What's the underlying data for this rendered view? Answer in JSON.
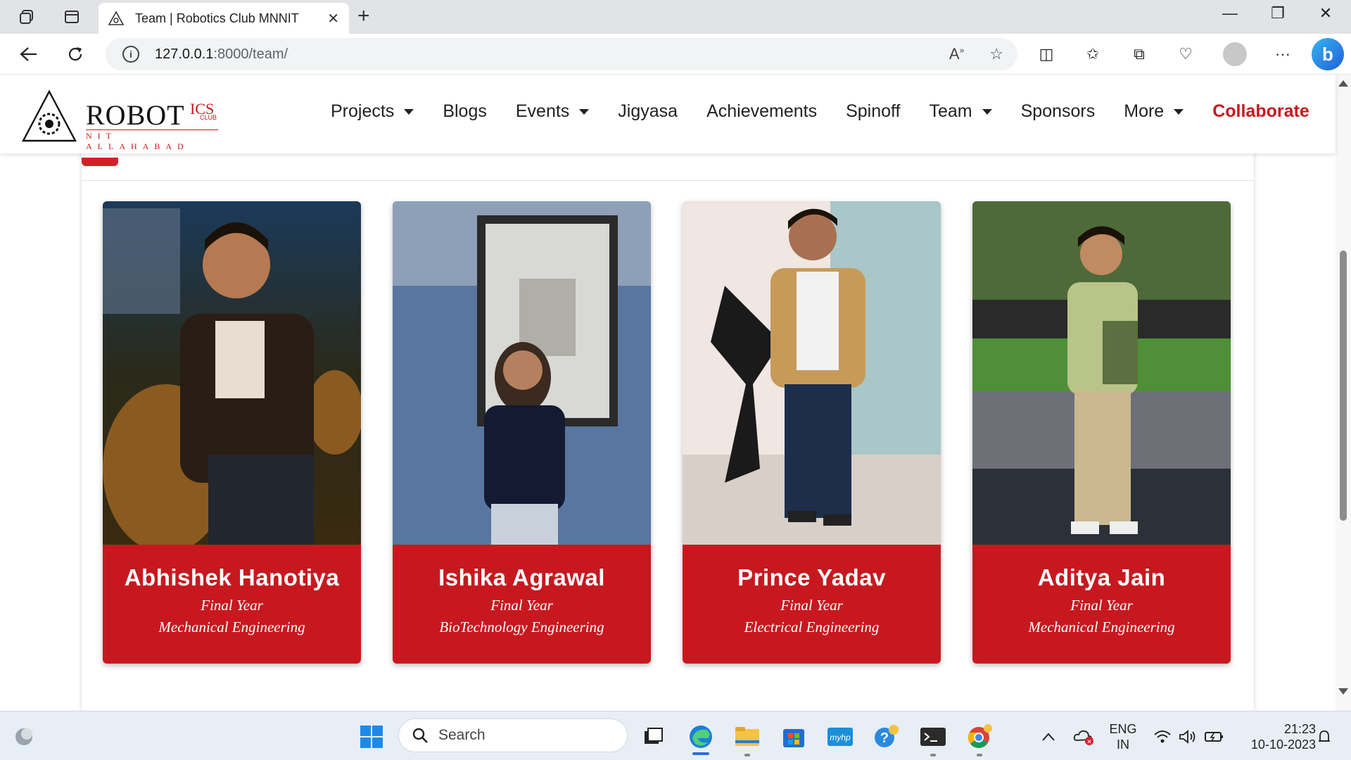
{
  "browser": {
    "tab_title": "Team | Robotics Club MNNIT",
    "url_host": "127.0.0.1",
    "url_rest": ":8000/team/"
  },
  "site": {
    "logo_main": "ROBOT",
    "logo_ics": "ICS",
    "logo_club": "CLUB",
    "logo_sub": "NIT ALLAHABAD",
    "accent_color": "#c8181f",
    "nav": {
      "projects": "Projects",
      "blogs": "Blogs",
      "events": "Events",
      "jigyasa": "Jigyasa",
      "achievements": "Achievements",
      "spinoff": "Spinoff",
      "team": "Team",
      "sponsors": "Sponsors",
      "more": "More",
      "collaborate": "Collaborate"
    }
  },
  "members": [
    {
      "name": "Abhishek Hanotiya",
      "year": "Final Year",
      "branch": "Mechanical Engineering"
    },
    {
      "name": "Ishika Agrawal",
      "year": "Final Year",
      "branch": "BioTechnology Engineering"
    },
    {
      "name": "Prince Yadav",
      "year": "Final Year",
      "branch": "Electrical Engineering"
    },
    {
      "name": "Aditya Jain",
      "year": "Final Year",
      "branch": "Mechanical Engineering"
    }
  ],
  "taskbar": {
    "search_label": "Search",
    "lang_top": "ENG",
    "lang_bottom": "IN",
    "time": "21:23",
    "date": "10-10-2023"
  }
}
